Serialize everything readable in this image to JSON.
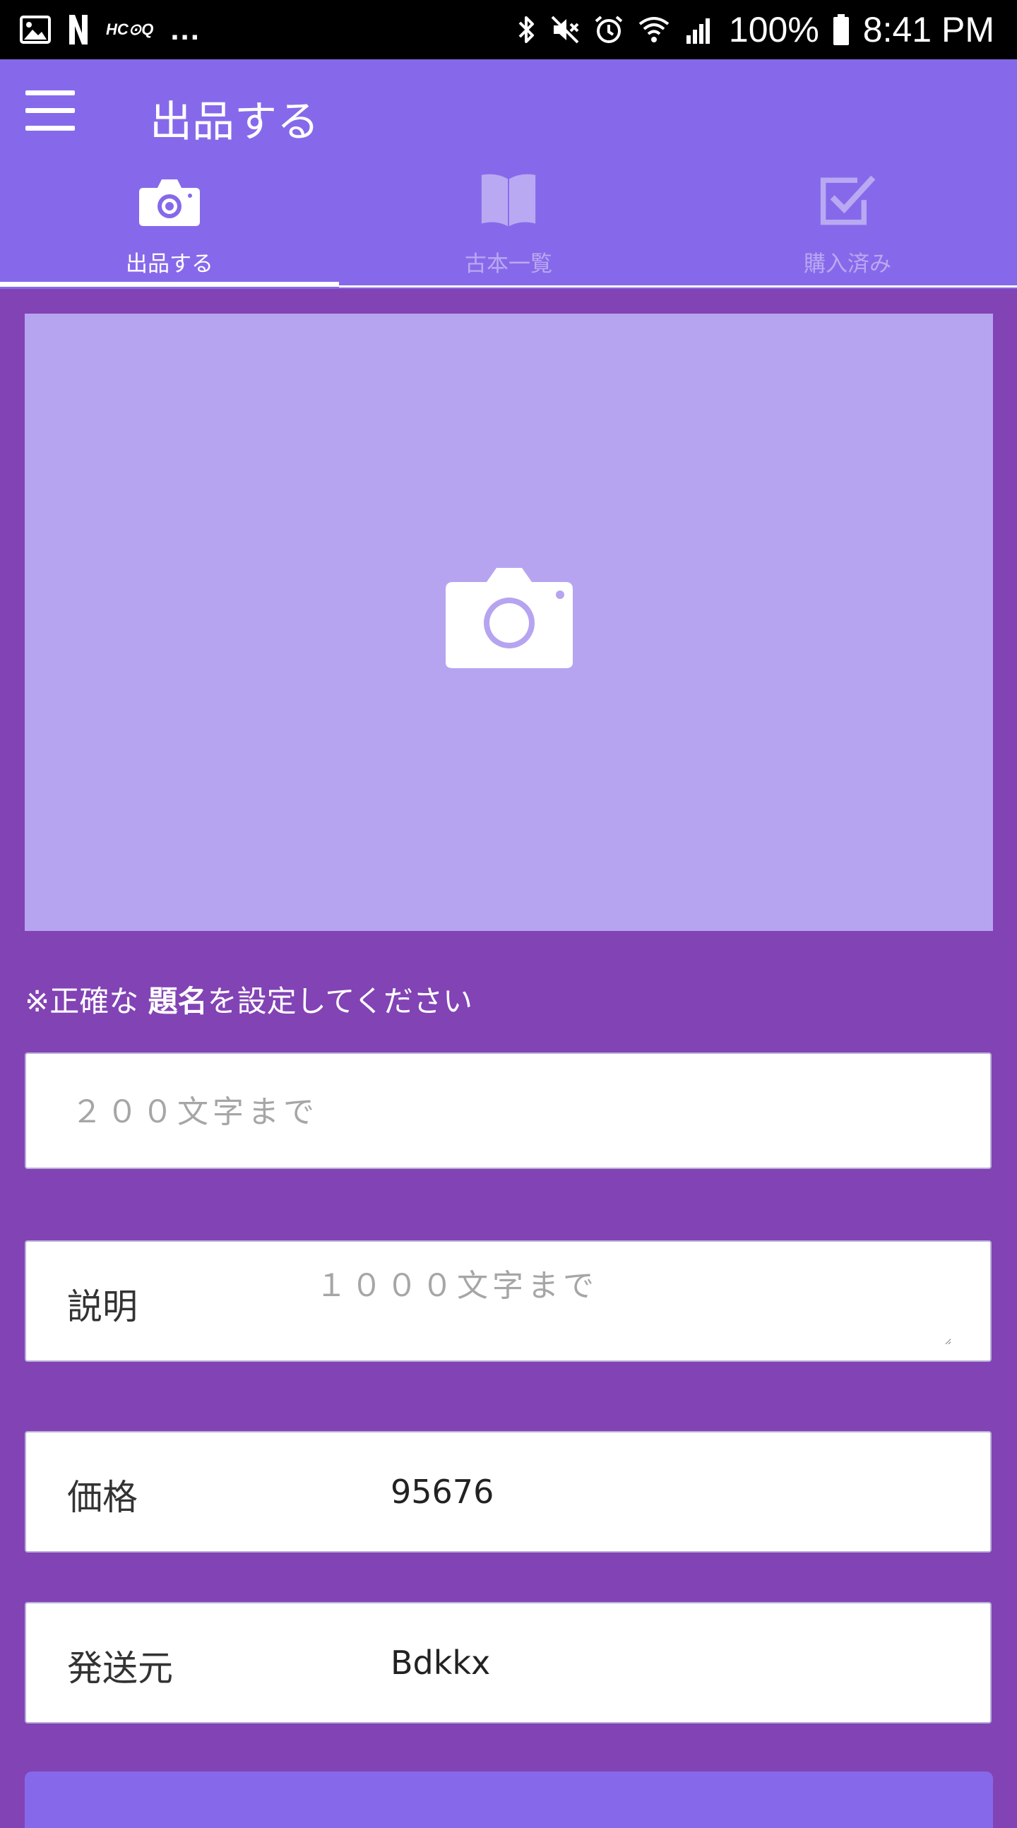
{
  "status_bar": {
    "notification_text": "HC⊙Q",
    "more": "...",
    "battery": "100%",
    "time": "8:41 PM"
  },
  "app_bar": {
    "title": "出品する"
  },
  "tabs": [
    {
      "label": "出品する",
      "icon": "camera-icon",
      "active": true
    },
    {
      "label": "古本一覧",
      "icon": "book-icon",
      "active": false
    },
    {
      "label": "購入済み",
      "icon": "checkbox-icon",
      "active": false
    }
  ],
  "photo_area": {
    "icon": "camera-icon"
  },
  "notice": {
    "prefix": "※正確な",
    "emphasis": "題名",
    "suffix": "を設定してください"
  },
  "form": {
    "title_placeholder": "２００文字まで",
    "title_value": "",
    "description_label": "説明",
    "description_placeholder": "１０００文字まで",
    "price_label": "価格",
    "price_value": "95676",
    "origin_label": "発送元",
    "origin_value": "Bdkkx"
  },
  "colors": {
    "background": "#8243B5",
    "app_bar": "#8669EA",
    "photo_area": "#B6A4F0",
    "inactive_tab": "#B9A9F2"
  }
}
